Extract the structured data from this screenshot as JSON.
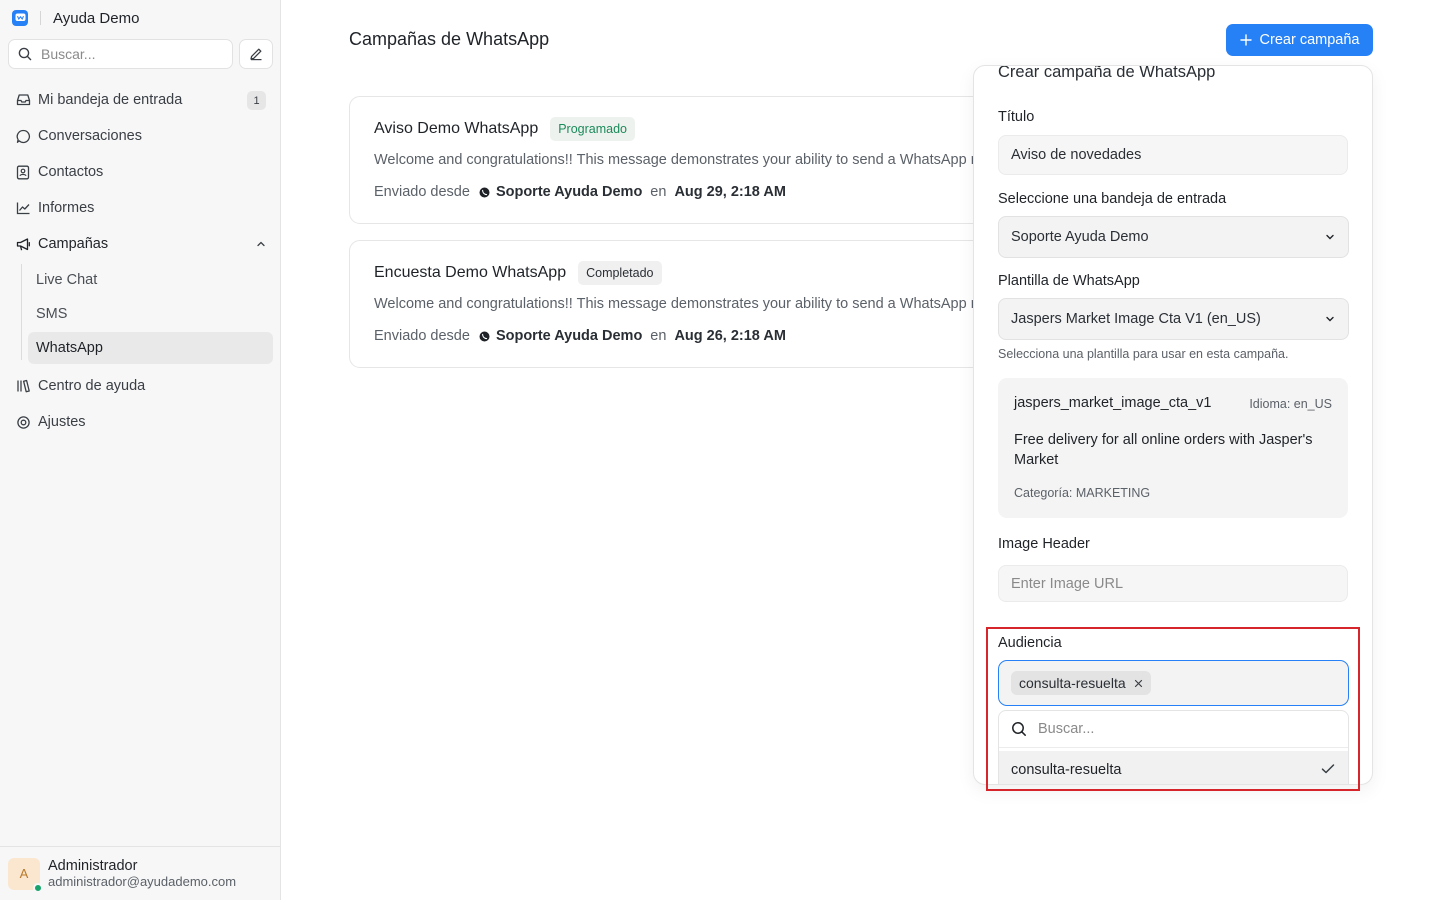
{
  "brand": {
    "name": "Ayuda Demo"
  },
  "sidebar": {
    "search_placeholder": "Buscar...",
    "items": [
      {
        "label": "Mi bandeja de entrada",
        "badge": "1"
      },
      {
        "label": "Conversaciones"
      },
      {
        "label": "Contactos"
      },
      {
        "label": "Informes"
      },
      {
        "label": "Campañas"
      },
      {
        "label": "Centro de ayuda"
      },
      {
        "label": "Ajustes"
      }
    ],
    "campaign_subitems": [
      {
        "label": "Live Chat"
      },
      {
        "label": "SMS"
      },
      {
        "label": "WhatsApp",
        "active": true
      }
    ]
  },
  "user": {
    "initial": "A",
    "name": "Administrador",
    "email": "administrador@ayudademo.com"
  },
  "main": {
    "title": "Campañas de WhatsApp",
    "create_button": "Crear campaña",
    "campaigns": [
      {
        "title": "Aviso Demo WhatsApp",
        "status": "Programado",
        "message": "Welcome and congratulations!! This message demonstrates your ability to send a WhatsApp message notification from the Marketplace.",
        "sent_from_label": "Enviado desde",
        "inbox": "Soporte Ayuda Demo",
        "on_label": "en",
        "date": "Aug 29, 2:18 AM"
      },
      {
        "title": "Encuesta Demo WhatsApp",
        "status": "Completado",
        "message": "Welcome and congratulations!! This message demonstrates your ability to send a WhatsApp message notification from the Marketplace.",
        "sent_from_label": "Enviado desde",
        "inbox": "Soporte Ayuda Demo",
        "on_label": "en",
        "date": "Aug 26, 2:18 AM"
      }
    ]
  },
  "form": {
    "title": "Crear campaña de WhatsApp",
    "title_label": "Título",
    "title_value": "Aviso de novedades",
    "inbox_label": "Seleccione una bandeja de entrada",
    "inbox_value": "Soporte Ayuda Demo",
    "template_label": "Plantilla de WhatsApp",
    "template_value": "Jaspers Market Image Cta V1 (en_US)",
    "template_help": "Selecciona una plantilla para usar en esta campaña.",
    "template_preview": {
      "name": "jaspers_market_image_cta_v1",
      "language": "Idioma: en_US",
      "body": "Free delivery for all online orders with Jasper's Market",
      "category": "Categoría: MARKETING"
    },
    "image_header_label": "Image Header",
    "image_header_placeholder": "Enter Image URL",
    "audience_label": "Audiencia",
    "audience_selected": "consulta-resuelta",
    "audience_search_placeholder": "Buscar...",
    "audience_option": "consulta-resuelta"
  },
  "colors": {
    "accent": "#2781f6",
    "scheduled": "#1b8a5a",
    "highlight": "#d6262b",
    "sidebar_bg": "#f7f7f7"
  }
}
